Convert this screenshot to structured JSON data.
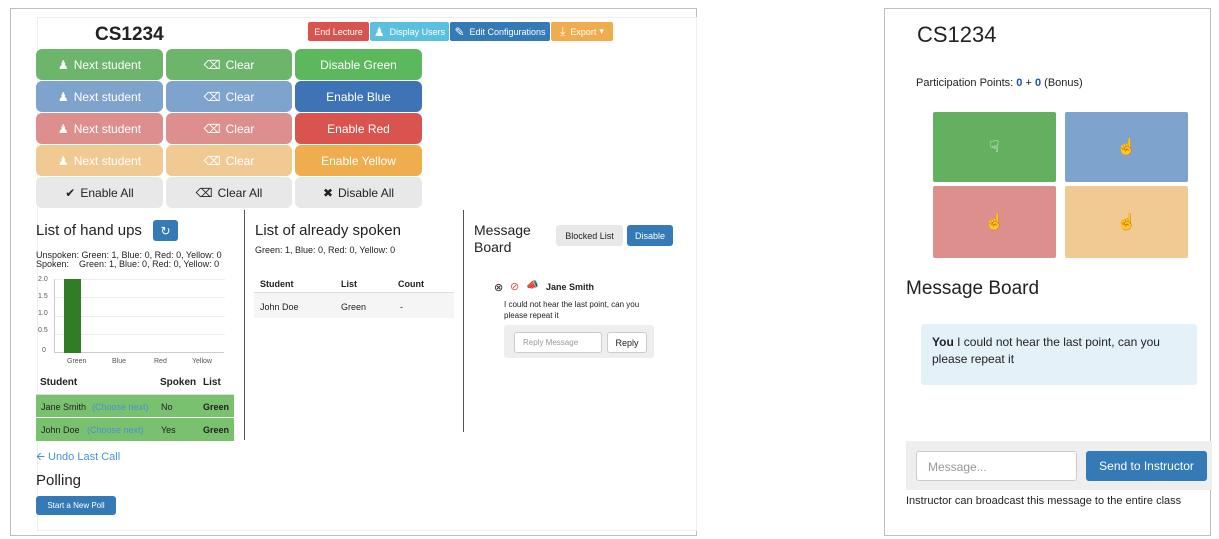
{
  "left": {
    "course": "CS1234",
    "topbar": {
      "end_lecture": "End Lecture",
      "display_users": "Display Users",
      "edit_config": "Edit Configurations",
      "export": "Export"
    },
    "rows": [
      {
        "next": "Next student",
        "clear": "Clear",
        "toggle": "Disable Green"
      },
      {
        "next": "Next student",
        "clear": "Clear",
        "toggle": "Enable Blue"
      },
      {
        "next": "Next student",
        "clear": "Clear",
        "toggle": "Enable Red"
      },
      {
        "next": "Next student",
        "clear": "Clear",
        "toggle": "Enable Yellow"
      }
    ],
    "all_row": {
      "enable_all": "Enable All",
      "clear_all": "Clear All",
      "disable_all": "Disable All"
    },
    "handups": {
      "title": "List of hand ups",
      "unspoken": "Unspoken: Green: 1, Blue: 0, Red: 0, Yellow: 0",
      "spoken": "Spoken:    Green: 1, Blue: 0, Red: 0, Yellow: 0",
      "chart_data": {
        "type": "bar",
        "categories": [
          "Green",
          "Blue",
          "Red",
          "Yellow"
        ],
        "values": [
          2,
          0,
          0,
          0
        ],
        "yticks": [
          "2.0",
          "1.5",
          "1.0",
          "0.5",
          "0"
        ],
        "ylim": [
          0,
          2
        ]
      },
      "headers": {
        "student": "Student",
        "spoken": "Spoken",
        "list": "List"
      },
      "rows": [
        {
          "name": "Jane Smith",
          "choose": "(Choose next)",
          "spoken": "No",
          "list": "Green"
        },
        {
          "name": "John Doe",
          "choose": "(Choose next)",
          "spoken": "Yes",
          "list": "Green"
        }
      ],
      "undo": "Undo Last Call"
    },
    "spoken_list": {
      "title": "List of already spoken",
      "counts": "Green: 1, Blue: 0, Red: 0, Yellow: 0",
      "headers": {
        "student": "Student",
        "list": "List",
        "count": "Count"
      },
      "rows": [
        {
          "student": "John Doe",
          "list": "Green",
          "count": "-"
        }
      ]
    },
    "message_board": {
      "title_1": "Message",
      "title_2": "Board",
      "blocked": "Blocked List",
      "disable": "Disable",
      "sender": "Jane Smith",
      "message": "I could not hear the last point, can you please repeat it",
      "reply_placeholder": "Reply Message",
      "reply": "Reply"
    },
    "polling": {
      "title": "Polling",
      "start": "Start a New Poll"
    }
  },
  "right": {
    "course": "CS1234",
    "points_label": "Participation Points:",
    "points": "0",
    "plus": "+",
    "bonus": "0",
    "bonus_label": "(Bonus)",
    "board_title": "Message Board",
    "msg_you": "You",
    "msg_text": "I could not hear the last point, can you please repeat it",
    "input_placeholder": "Message...",
    "send": "Send to Instructor",
    "note": "Instructor can broadcast this message to the entire class"
  },
  "colors": {
    "green": "#6cb56a",
    "blue": "#7ea3cc",
    "red": "#dc8f8c",
    "yellow": "#f0c993"
  }
}
